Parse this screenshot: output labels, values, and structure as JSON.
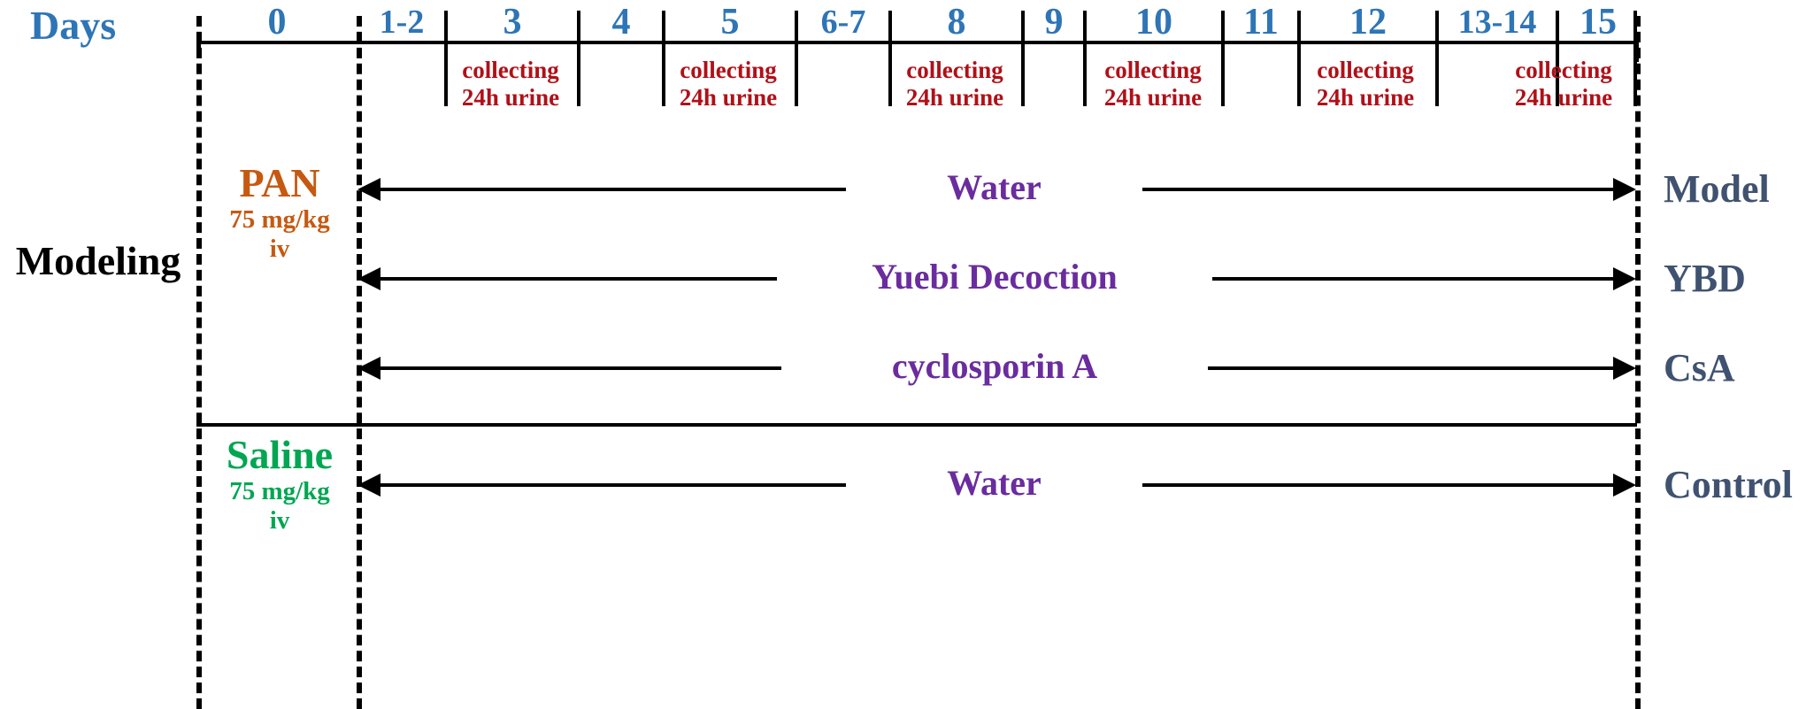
{
  "timeline": {
    "axis_label": "Days",
    "days": [
      "0",
      "1-2",
      "3",
      "4",
      "5",
      "6-7",
      "8",
      "9",
      "10",
      "11",
      "12",
      "13-14",
      "15"
    ],
    "collection_label_line1": "collecting",
    "collection_label_line2": "24h urine",
    "collection_days": [
      "3",
      "5",
      "8",
      "10",
      "12",
      "15"
    ],
    "collection_count": 6
  },
  "left": {
    "modeling_label": "Modeling",
    "modeling_dose": {
      "name": "PAN",
      "amount": "75 mg/kg",
      "route": "iv",
      "color": "#C65911"
    },
    "control_dose": {
      "name": "Saline",
      "amount": "75 mg/kg",
      "route": "iv",
      "color": "#00A651"
    }
  },
  "rows": [
    {
      "treatment": "Water",
      "group": "Model"
    },
    {
      "treatment": "Yuebi Decoction",
      "group": "YBD"
    },
    {
      "treatment": "cyclosporin A",
      "group": "CsA"
    },
    {
      "treatment": "Water",
      "group": "Control"
    }
  ],
  "colors": {
    "day_number": "#2E75B6",
    "collection_text": "#B01018",
    "treatment_text": "#6A2C9E",
    "group_text": "#3F5270",
    "modeling_text": "#000000",
    "line": "#000000"
  }
}
